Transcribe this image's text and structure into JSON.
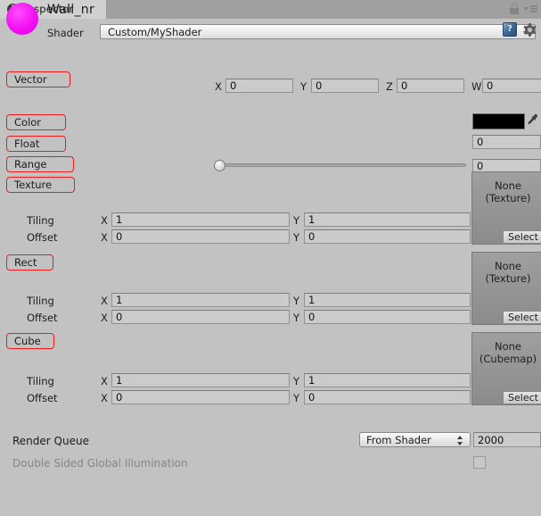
{
  "window": {
    "tab_label": "Inspector",
    "tab_icon": "info-icon",
    "lock_icon": "lock-icon",
    "menu_icon": "hamburger-menu-icon"
  },
  "material": {
    "name": "Wall_nr",
    "preview_color": "#f20df2",
    "shader_label": "Shader",
    "shader_value": "Custom/MyShader",
    "help_icon": "book-help-icon",
    "settings_icon": "gear-icon"
  },
  "properties": {
    "vector": {
      "label": "Vector",
      "x_axis": "X",
      "x_value": "0",
      "y_axis": "Y",
      "y_value": "0",
      "z_axis": "Z",
      "z_value": "0",
      "w_axis": "W",
      "w_value": "0"
    },
    "color": {
      "label": "Color",
      "swatch_color": "#000000",
      "eyedropper_icon": "eyedropper-icon"
    },
    "float": {
      "label": "Float",
      "value": "0"
    },
    "range": {
      "label": "Range",
      "value": "0",
      "slider_position_percent": 0
    },
    "texture": {
      "label": "Texture",
      "slot_line1": "None",
      "slot_line2": "(Texture)",
      "select_label": "Select",
      "tiling_label": "Tiling",
      "tiling_x_axis": "X",
      "tiling_x": "1",
      "tiling_y_axis": "Y",
      "tiling_y": "1",
      "offset_label": "Offset",
      "offset_x_axis": "X",
      "offset_x": "0",
      "offset_y_axis": "Y",
      "offset_y": "0"
    },
    "rect": {
      "label": "Rect",
      "slot_line1": "None",
      "slot_line2": "(Texture)",
      "select_label": "Select",
      "tiling_label": "Tiling",
      "tiling_x_axis": "X",
      "tiling_x": "1",
      "tiling_y_axis": "Y",
      "tiling_y": "1",
      "offset_label": "Offset",
      "offset_x_axis": "X",
      "offset_x": "0",
      "offset_y_axis": "Y",
      "offset_y": "0"
    },
    "cube": {
      "label": "Cube",
      "slot_line1": "None",
      "slot_line2": "(Cubemap)",
      "select_label": "Select",
      "tiling_label": "Tiling",
      "tiling_x_axis": "X",
      "tiling_x": "1",
      "tiling_y_axis": "Y",
      "tiling_y": "1",
      "offset_label": "Offset",
      "offset_x_axis": "X",
      "offset_x": "0",
      "offset_y_axis": "Y",
      "offset_y": "0"
    }
  },
  "footer": {
    "render_queue_label": "Render Queue",
    "render_queue_mode": "From Shader",
    "render_queue_value": "2000",
    "double_sided_gi_label": "Double Sided Global Illumination",
    "double_sided_gi_checked": false
  }
}
